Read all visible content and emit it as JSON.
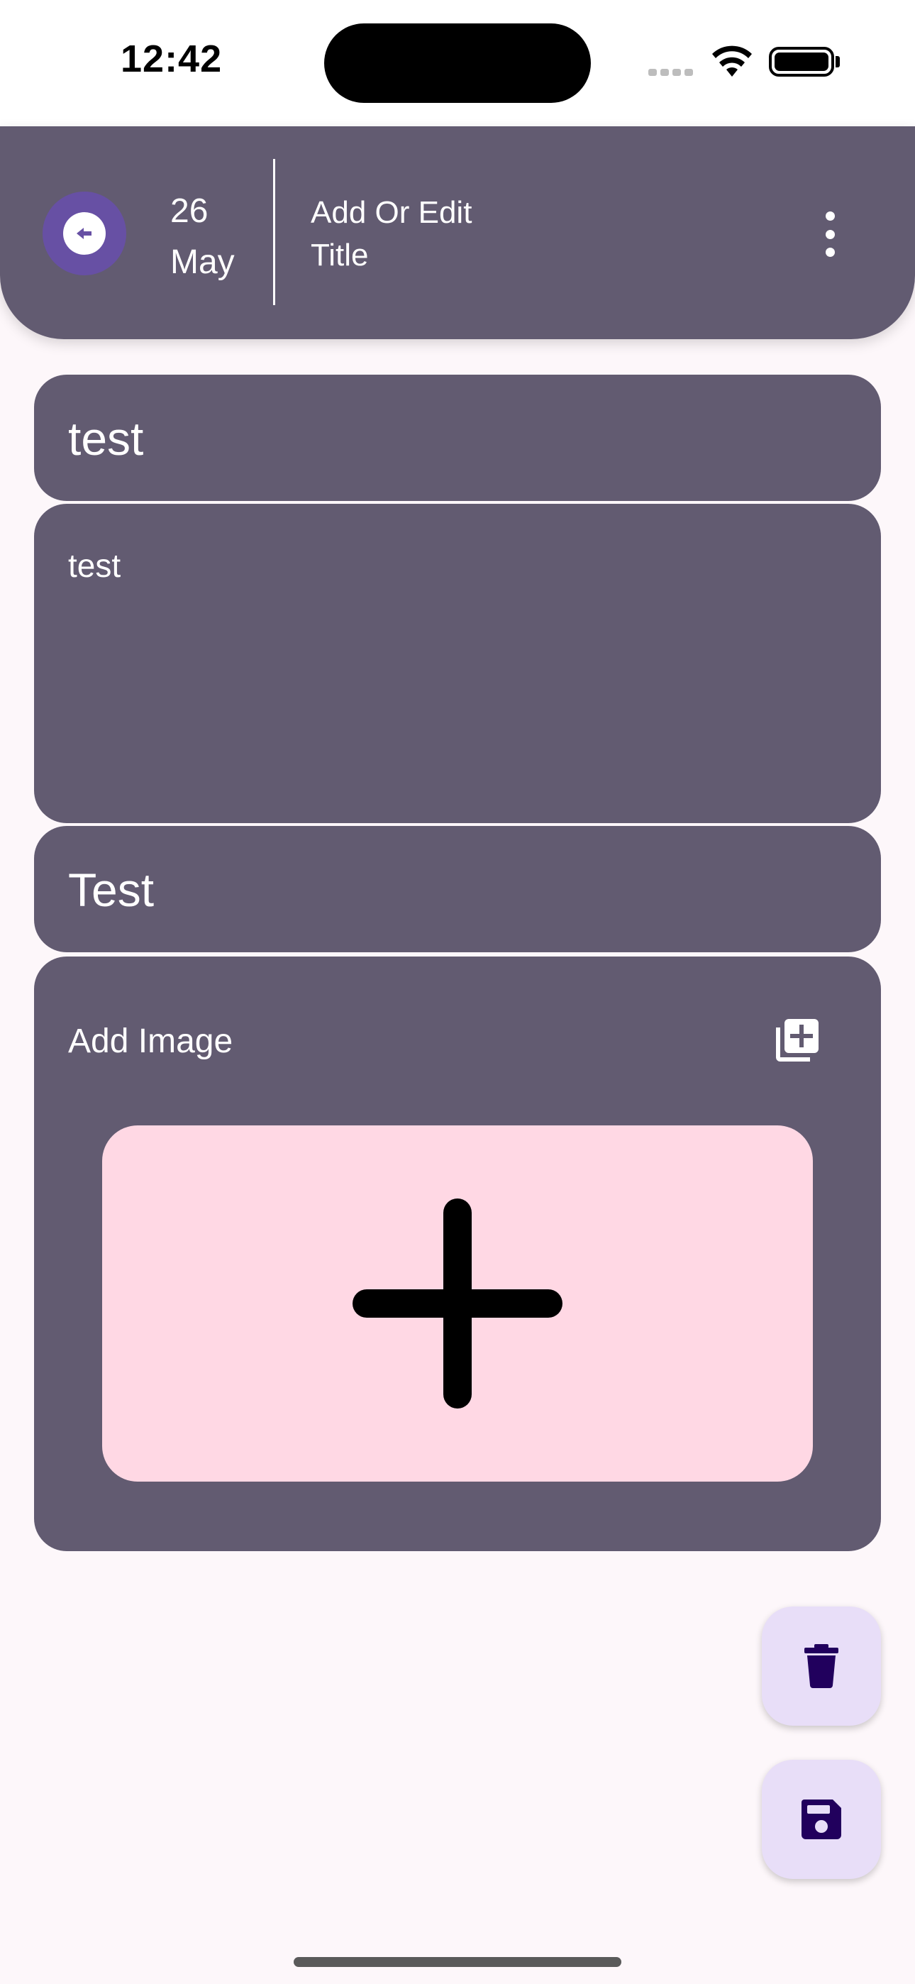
{
  "status_bar": {
    "time": "12:42"
  },
  "header": {
    "date_day": "26",
    "date_month": "May",
    "title": "Add Or Edit Title",
    "back_icon": "arrow-left-circle-icon",
    "menu_icon": "more-vertical-icon"
  },
  "form": {
    "title_value": "test",
    "description_value": "test",
    "category_value": "Test",
    "add_image_label": "Add Image",
    "add_image_icon": "add-photo-library-icon",
    "image_placeholder_icon": "plus-icon"
  },
  "actions": {
    "delete_icon": "trash-icon",
    "save_icon": "floppy-disk-icon"
  },
  "colors": {
    "background": "#FDF7FA",
    "surface": "#625B71",
    "primary": "#6750A4",
    "image_placeholder": "#FFD8E4",
    "fab_container": "#E8DEF8",
    "fab_icon": "#21005D"
  }
}
